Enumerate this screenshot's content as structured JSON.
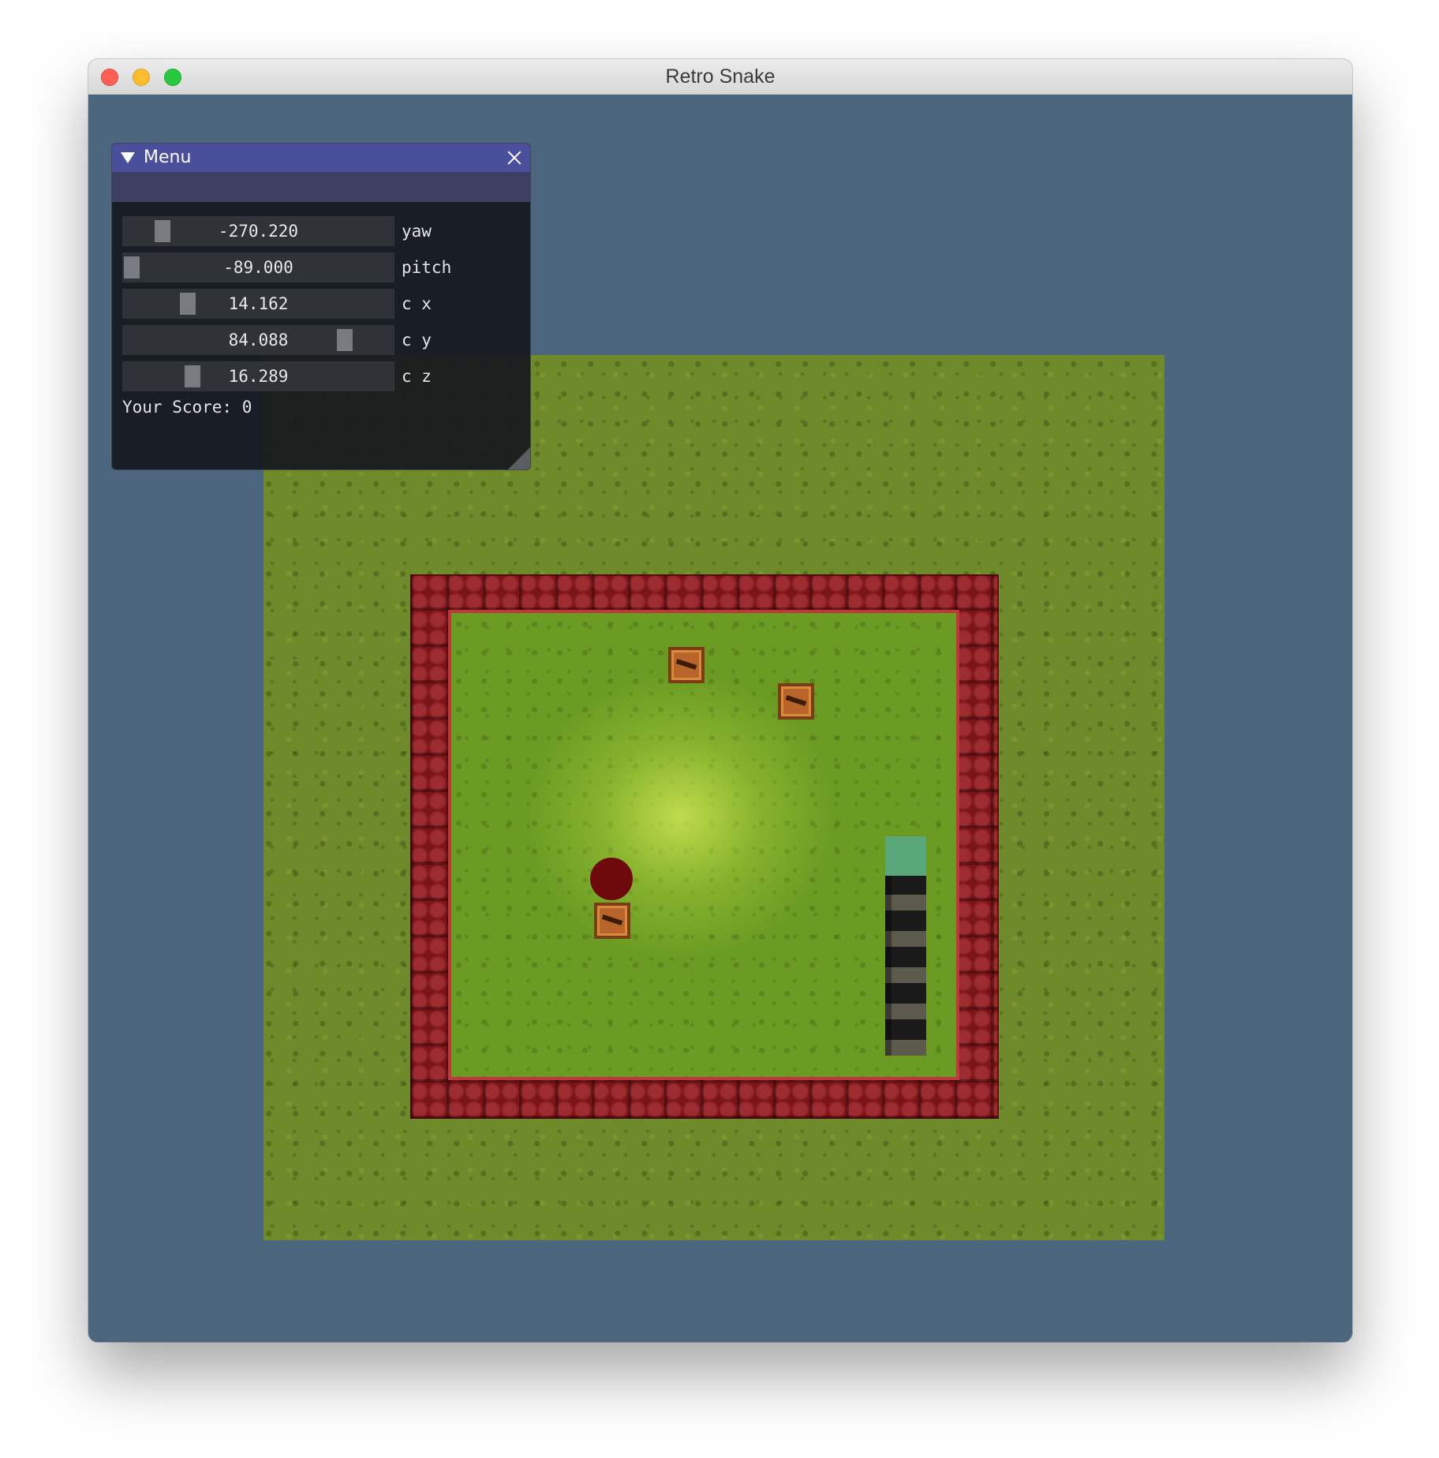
{
  "window": {
    "title": "Retro Snake"
  },
  "menu": {
    "title": "Menu",
    "sliders": [
      {
        "label": "yaw",
        "value": "-270.220",
        "fraction": 0.12
      },
      {
        "label": "pitch",
        "value": "-89.000",
        "fraction": 0.0
      },
      {
        "label": "c x",
        "value": "14.162",
        "fraction": 0.22
      },
      {
        "label": "c y",
        "value": "84.088",
        "fraction": 0.84
      },
      {
        "label": "c z",
        "value": "16.289",
        "fraction": 0.24
      }
    ],
    "score_text": "Your Score: 0"
  },
  "scene": {
    "background_color": "#4c6680",
    "ground": "grass",
    "wall": "red-brick",
    "food": "red-orb",
    "obstacles": [
      "crate",
      "crate",
      "crate"
    ],
    "snake": {
      "head_color": "#5aa87a",
      "segments": 5
    }
  }
}
